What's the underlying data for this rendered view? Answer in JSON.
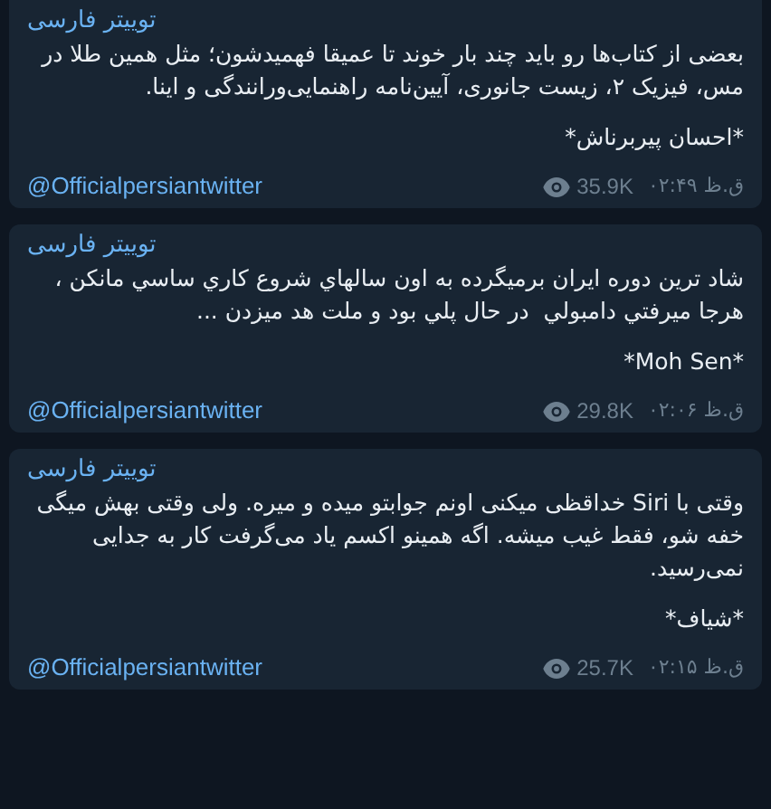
{
  "posts": [
    {
      "channel": "توییتر فارسی",
      "text": "بعضی از کتاب‌ها رو باید چند بار خوند تا عمیقا فهمیدشون؛ مثل همین طلا در\nمس، فیزیک ۲، زیست جانوری، آیین‌نامه راهنمایی‌ورانندگی و اینا.",
      "signature": "*احسان پیربرناش*",
      "handle": "@Officialpersiantwitter",
      "views": "35.9K",
      "time": "ق.ظ ۰۲:۴۹"
    },
    {
      "channel": "توییتر فارسی",
      "text": "شاد ترین دوره ایران برمیگرده به اون سالهاي شروع كاري ساسي مانكن ،\nهرجا ميرفتي دامبولي  در حال پلي بود و ملت هد ميزدن ...",
      "signature": "*Moh Sen*",
      "handle": "@Officialpersiantwitter",
      "views": "29.8K",
      "time": "ق.ظ ۰۲:۰۶"
    },
    {
      "channel": "توییتر فارسی",
      "text": "وقتی با Siri خداقظی میکنی اونم جوابتو میده و میره. ولی وقتی بهش میگی\nخفه شو، فقط غیب میشه. اگه همینو اکسم یاد می‌گرفت کار به جدایی\nنمی‌رسید.",
      "signature": "*شیاف*",
      "handle": "@Officialpersiantwitter",
      "views": "25.7K",
      "time": "ق.ظ ۰۲:۱۵"
    }
  ]
}
